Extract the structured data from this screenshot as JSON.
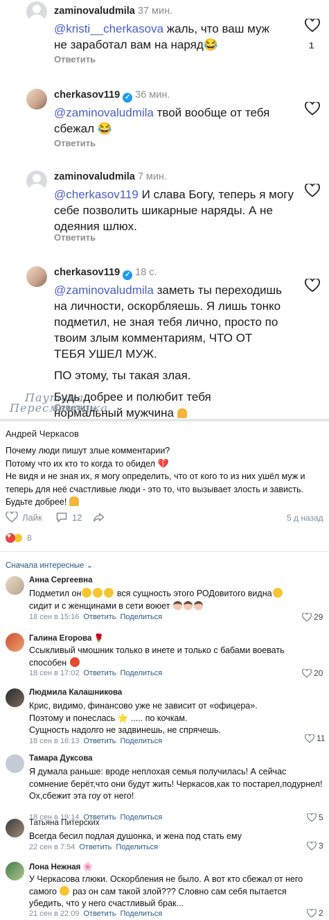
{
  "instagram": {
    "comments": [
      {
        "user": "zaminovaludmila",
        "time": "37 мин.",
        "mention": "@kristi__cherkasova",
        "text": " жаль, что ваш муж не заработал вам на наряд",
        "reply": "Ответить",
        "likes": "1"
      },
      {
        "user": "cherkasov119",
        "time": "36 мин.",
        "mention": "@zaminovaludmila",
        "text": " твой вообще от тебя сбежал",
        "reply": "Ответить",
        "likes": ""
      },
      {
        "user": "zaminovaludmila",
        "time": "7 мин.",
        "mention": "@cherkasov119",
        "text": " И слава Богу, теперь я могу себе позволить шикарные наряды. А не одеяния шлюх.",
        "reply": "Ответить",
        "likes": ""
      },
      {
        "user": "cherkasov119",
        "time": "18 с.",
        "mention": "@zaminovaludmila",
        "text": " заметь ты переходишь на личности, оскорбляешь. Я лишь тонко подметил, не зная тебя лично, просто по твоим злым комментариям, ЧТО ОТ ТЕБЯ УШЕЛ МУЖ.",
        "text2": "ПО этому, ты такая злая.",
        "text3": "Будь добрее и полюбит тебя нормальный мужчина",
        "reply": "Ответить",
        "likes": ""
      }
    ],
    "watermark_line1": "Паутина",
    "watermark_line2": "Пересмешника"
  },
  "post": {
    "author": "Андрей Черкасов",
    "lines": [
      "Почему люди пишут злые комментарии?",
      "Потому что их кто то когда то обидел",
      "Не видя и не зная их, я могу определить, что от кого то из них ушёл муж и теперь для неё счастливые люди - это то, что вызывает злость и зависть.",
      "Будьте добрее!"
    ],
    "like_label": "Лайк",
    "comments_count": "12",
    "date": "5 д назад",
    "reactions_count": "8",
    "sort_label": "Сначала интересные"
  },
  "comments": [
    {
      "name": "Анна Сергеевна",
      "text_a": "Подметил он",
      "text_b": " вся сущность этого РОДовитого видна",
      "text_c": " сидит и с женщинами в сети воюет",
      "date": "18 сен в 15:16",
      "reply": "Ответить",
      "share": "Поделиться",
      "likes": "29"
    },
    {
      "name": "Галина Егорова",
      "text": "Ссыкливый чмошник только в инете и только с бабами воевать способен",
      "date": "18 сен в 17:02",
      "reply": "Ответить",
      "share": "Поделиться",
      "likes": "20"
    },
    {
      "name": "Людмила Калашникова",
      "line1": "Крис, видимо, финансово уже не зависит от «офицера».",
      "line2a": "Поэтому и понеслась",
      "line2b": " ..... по кочкам.",
      "line3": "Сущность надолго не задвинешь, не спрячешь.",
      "date": "18 сен в 16:13",
      "reply": "Ответить",
      "share": "Поделиться",
      "likes": "11"
    },
    {
      "name": "Тамара Дуксова",
      "text": "Я думала раньше: вроде неплохая семья получилась! А сейчас сомнение берёт,что они будут жить! Черкасов,как то постарел,подурнел! Ох,сбежит эта гоу от него!",
      "date": "18 сен в 19:14",
      "reply": "Ответить",
      "share": "Поделиться",
      "likes": "5"
    },
    {
      "name": "Татьяна Питерских",
      "text": "Всегда бесил подлая душонка, и жена под стать ему",
      "date": "22 сен в 7:54",
      "reply": "Ответить",
      "share": "Поделиться",
      "likes": "3"
    },
    {
      "name": "Лона Нежная",
      "text_a": "У Черкасова глюки. Оскорбления не было. А вот кто сбежал от него самого",
      "text_b": " раз он сам такой злой??? Словно сам себя пытается убедить, что у него счастливый брак...",
      "date": "21 сен в 22:09",
      "reply": "Ответить",
      "share": "Поделиться",
      "likes": "2"
    }
  ]
}
